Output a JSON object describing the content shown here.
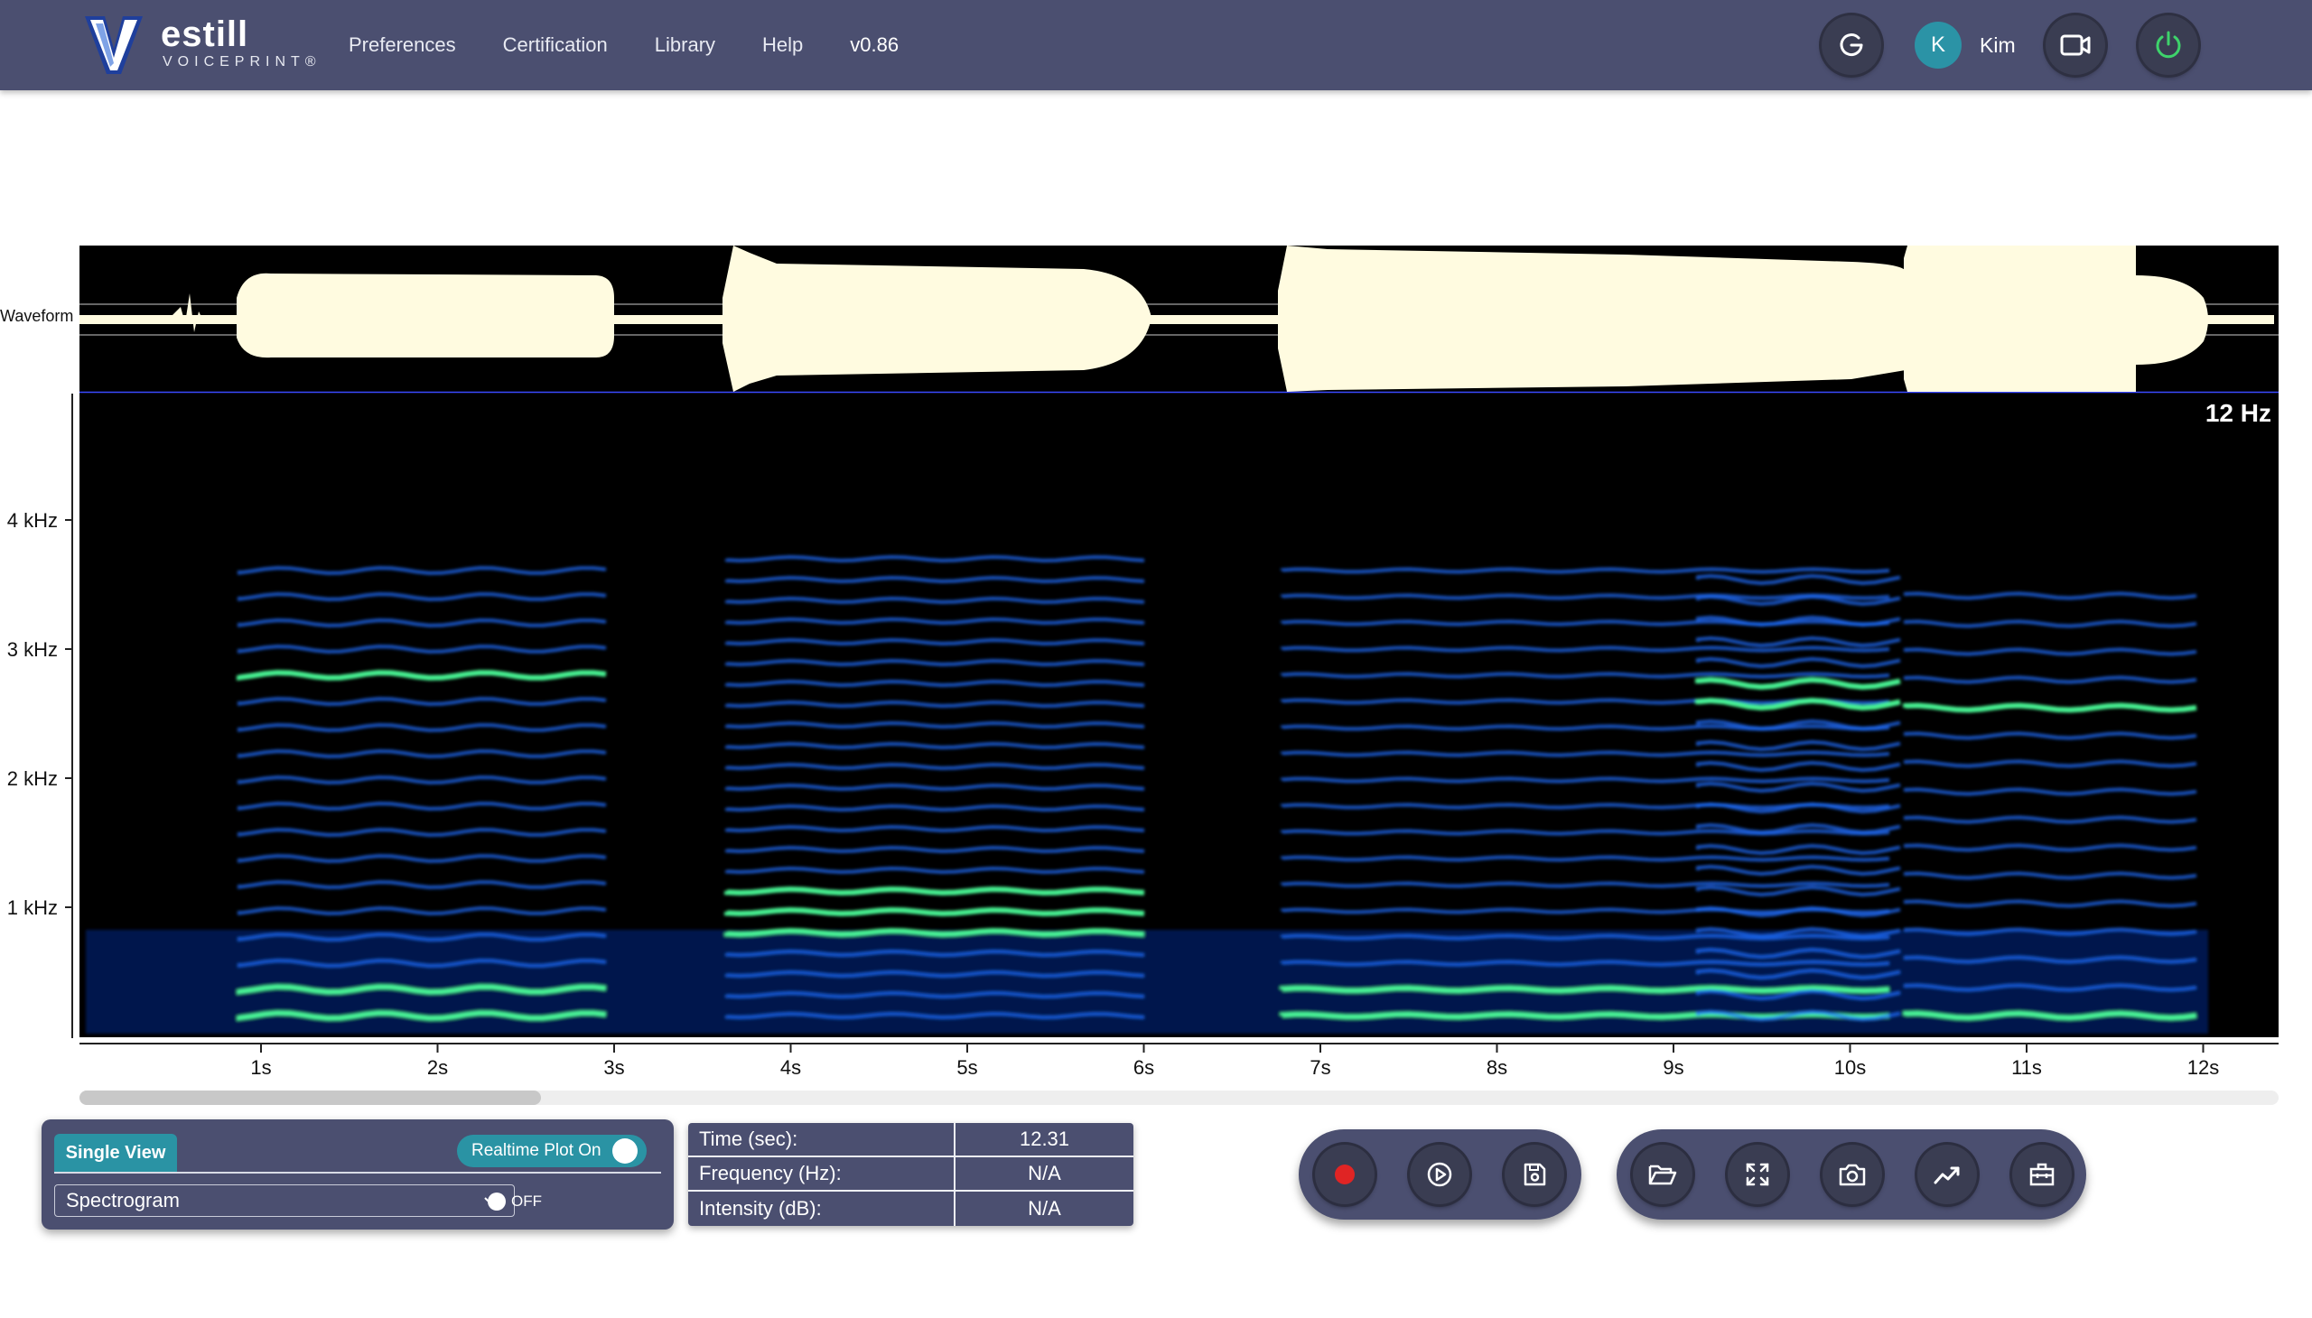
{
  "brand": {
    "name": "estill",
    "tagline": "VOICEPRINT®"
  },
  "nav": {
    "items": [
      "Preferences",
      "Certification",
      "Library",
      "Help"
    ],
    "version": "v0.86"
  },
  "header_actions": {
    "refresh_icon": "refresh-icon",
    "user_initial": "K",
    "user_name": "Kim",
    "video_icon": "video-camera-icon",
    "power_icon": "power-icon"
  },
  "plot": {
    "waveform_label": "Waveform",
    "frequency_readout": "12 Hz",
    "y_ticks": [
      "4 kHz",
      "3 kHz",
      "2 kHz",
      "1 kHz"
    ],
    "x_ticks": [
      "1s",
      "2s",
      "3s",
      "4s",
      "5s",
      "6s",
      "7s",
      "8s",
      "9s",
      "10s",
      "11s",
      "12s"
    ],
    "scroll_position": 0.21
  },
  "view_panel": {
    "tab_label": "Single View",
    "realtime_label": "Realtime Plot On",
    "realtime_on": true,
    "selected_view": "Spectrogram",
    "toggle_label": "OFF"
  },
  "info": {
    "rows": [
      {
        "label": "Time (sec):",
        "value": "12.31"
      },
      {
        "label": "Frequency (Hz):",
        "value": "N/A"
      },
      {
        "label": "Intensity (dB):",
        "value": "N/A"
      }
    ]
  },
  "controls": {
    "transport": [
      "record-icon",
      "play-icon",
      "save-icon"
    ],
    "tools": [
      "folder-open-icon",
      "fullscreen-icon",
      "camera-icon",
      "trend-line-icon",
      "toolbox-icon"
    ]
  },
  "colors": {
    "header_bg": "#4b4f70",
    "accent_teal": "#2a93a4",
    "waveform": "#fffbe0",
    "spectrogram_blue": "#1f6fff",
    "spectrogram_green": "#4cff9a",
    "record_red": "#e02424"
  }
}
